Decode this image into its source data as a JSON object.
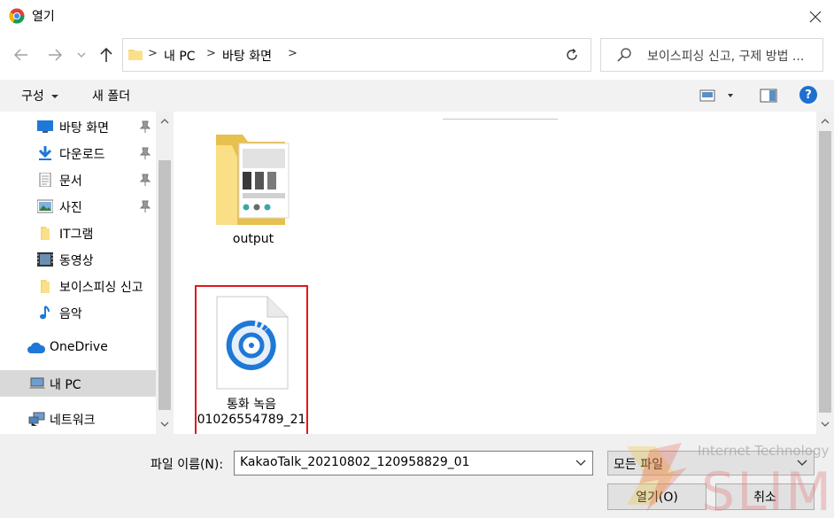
{
  "window": {
    "title": "열기"
  },
  "breadcrumb": {
    "items": [
      "내 PC",
      "바탕 화면"
    ]
  },
  "search": {
    "placeholder": "보이스피싱 신고, 구제 방법 ..."
  },
  "toolbar": {
    "organize_label": "구성",
    "new_folder_label": "새 폴더"
  },
  "sidebar": {
    "items": [
      {
        "label": "바탕 화면",
        "icon": "desktop-icon",
        "pinned": true
      },
      {
        "label": "다운로드",
        "icon": "download-icon",
        "pinned": true
      },
      {
        "label": "문서",
        "icon": "document-icon",
        "pinned": true
      },
      {
        "label": "사진",
        "icon": "picture-icon",
        "pinned": true
      },
      {
        "label": "IT그램",
        "icon": "folder-icon",
        "pinned": false
      },
      {
        "label": "동영상",
        "icon": "video-icon",
        "pinned": false
      },
      {
        "label": "보이스피싱 신고",
        "icon": "folder-icon",
        "pinned": false
      },
      {
        "label": "음악",
        "icon": "music-icon",
        "pinned": false
      },
      {
        "label": "OneDrive",
        "icon": "cloud-icon",
        "pinned": false
      },
      {
        "label": "내 PC",
        "icon": "pc-icon",
        "pinned": false,
        "selected": true
      },
      {
        "label": "네트워크",
        "icon": "network-icon",
        "pinned": false
      }
    ]
  },
  "files": [
    {
      "name": "output",
      "type": "folder"
    },
    {
      "name_line1": "통화 녹음",
      "name_line2": "01026554789_21",
      "type": "audio",
      "highlighted": true
    }
  ],
  "bottom": {
    "filename_label": "파일 이름(N):",
    "filename_value": "KakaoTalk_20210802_120958829_01",
    "filetype_value": "모든 파일",
    "open_label": "열기(O)",
    "cancel_label": "취소"
  },
  "watermark": {
    "line1": "Internet Technology",
    "line2": "SLIM"
  },
  "colors": {
    "highlight": "#e0171b",
    "accent": "#1e78d7",
    "selected": "#d9d9d9"
  }
}
